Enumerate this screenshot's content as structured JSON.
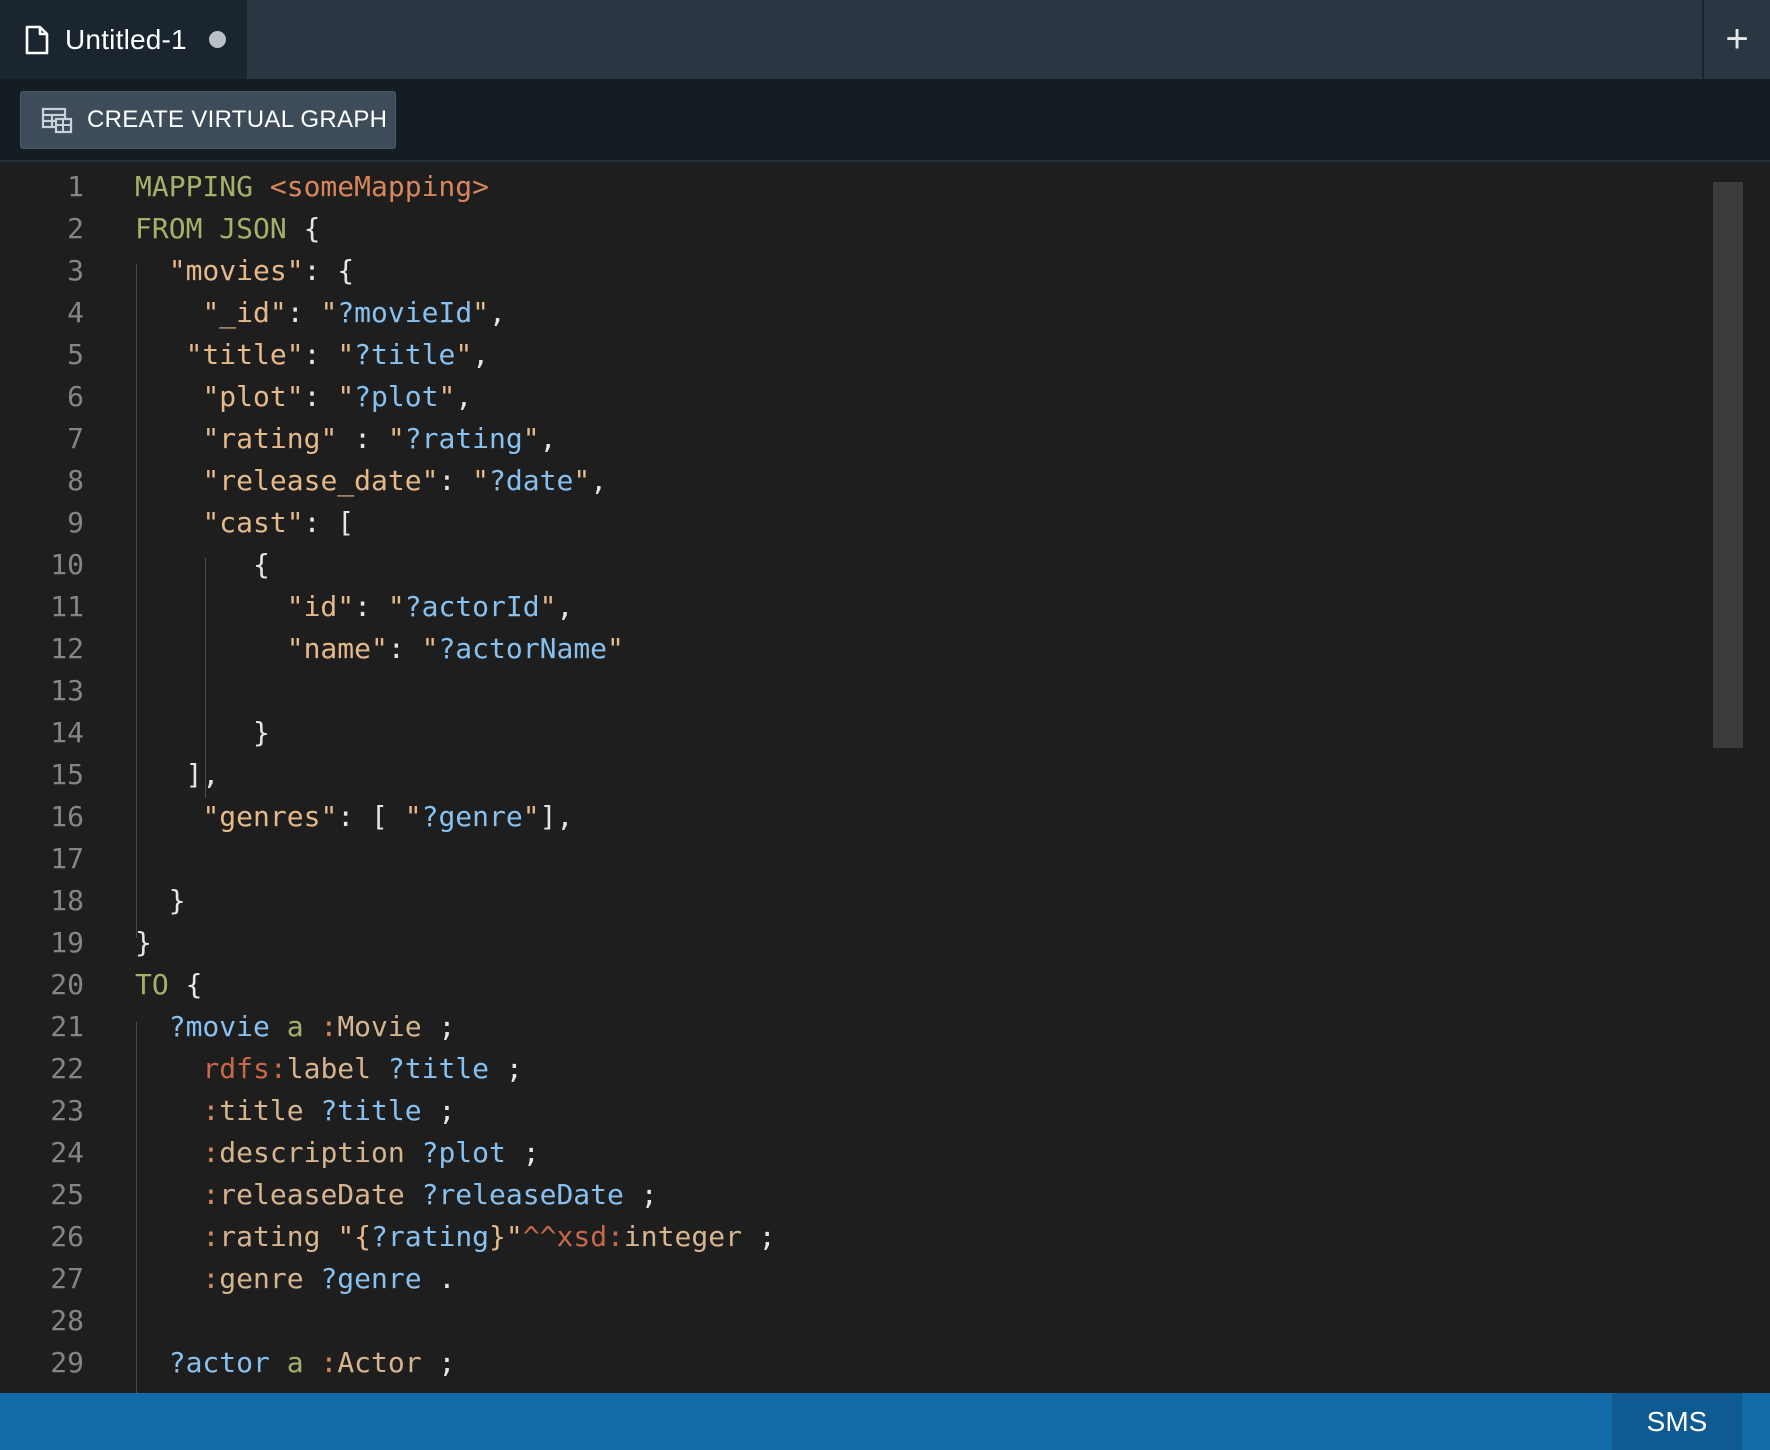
{
  "tabs": [
    {
      "title": "Untitled-1",
      "modified": true
    }
  ],
  "new_tab_label": "+",
  "toolbar": {
    "create_virtual_graph_label": "CREATE VIRTUAL GRAPH"
  },
  "editor": {
    "lines": [
      {
        "n": "1",
        "tokens": [
          [
            "kw",
            "MAPPING "
          ],
          [
            "iri",
            "<someMapping>"
          ]
        ]
      },
      {
        "n": "2",
        "tokens": [
          [
            "kw",
            "FROM JSON "
          ],
          [
            "pun",
            "{"
          ]
        ]
      },
      {
        "n": "3",
        "tokens": [
          [
            "pun",
            "  "
          ],
          [
            "key",
            "\"movies\""
          ],
          [
            "pun",
            ": {"
          ]
        ]
      },
      {
        "n": "4",
        "tokens": [
          [
            "pun",
            "    "
          ],
          [
            "key",
            "\"_id\""
          ],
          [
            "pun",
            ": "
          ],
          [
            "key",
            "\""
          ],
          [
            "var",
            "?movieId"
          ],
          [
            "key",
            "\""
          ],
          [
            "pun",
            ","
          ]
        ]
      },
      {
        "n": "5",
        "tokens": [
          [
            "pun",
            "   "
          ],
          [
            "key",
            "\"title\""
          ],
          [
            "pun",
            ": "
          ],
          [
            "key",
            "\""
          ],
          [
            "var",
            "?title"
          ],
          [
            "key",
            "\""
          ],
          [
            "pun",
            ","
          ]
        ]
      },
      {
        "n": "6",
        "tokens": [
          [
            "pun",
            "    "
          ],
          [
            "key",
            "\"plot\""
          ],
          [
            "pun",
            ": "
          ],
          [
            "key",
            "\""
          ],
          [
            "var",
            "?plot"
          ],
          [
            "key",
            "\""
          ],
          [
            "pun",
            ","
          ]
        ]
      },
      {
        "n": "7",
        "tokens": [
          [
            "pun",
            "    "
          ],
          [
            "key",
            "\"rating\""
          ],
          [
            "pun",
            " : "
          ],
          [
            "key",
            "\""
          ],
          [
            "var",
            "?rating"
          ],
          [
            "key",
            "\""
          ],
          [
            "pun",
            ","
          ]
        ]
      },
      {
        "n": "8",
        "tokens": [
          [
            "pun",
            "    "
          ],
          [
            "key",
            "\"release_date\""
          ],
          [
            "pun",
            ": "
          ],
          [
            "key",
            "\""
          ],
          [
            "var",
            "?date"
          ],
          [
            "key",
            "\""
          ],
          [
            "pun",
            ","
          ]
        ]
      },
      {
        "n": "9",
        "tokens": [
          [
            "pun",
            "    "
          ],
          [
            "key",
            "\"cast\""
          ],
          [
            "pun",
            ": ["
          ]
        ]
      },
      {
        "n": "10",
        "tokens": [
          [
            "pun",
            "       {"
          ]
        ]
      },
      {
        "n": "11",
        "tokens": [
          [
            "pun",
            "         "
          ],
          [
            "key",
            "\"id\""
          ],
          [
            "pun",
            ": "
          ],
          [
            "key",
            "\""
          ],
          [
            "var",
            "?actorId"
          ],
          [
            "key",
            "\""
          ],
          [
            "pun",
            ","
          ]
        ]
      },
      {
        "n": "12",
        "tokens": [
          [
            "pun",
            "         "
          ],
          [
            "key",
            "\"name\""
          ],
          [
            "pun",
            ": "
          ],
          [
            "key",
            "\""
          ],
          [
            "var",
            "?actorName"
          ],
          [
            "key",
            "\""
          ]
        ]
      },
      {
        "n": "13",
        "tokens": []
      },
      {
        "n": "14",
        "tokens": [
          [
            "pun",
            "       }"
          ]
        ]
      },
      {
        "n": "15",
        "tokens": [
          [
            "pun",
            "   ],"
          ]
        ]
      },
      {
        "n": "16",
        "tokens": [
          [
            "pun",
            "    "
          ],
          [
            "key",
            "\"genres\""
          ],
          [
            "pun",
            ": [ "
          ],
          [
            "key",
            "\""
          ],
          [
            "var",
            "?genre"
          ],
          [
            "key",
            "\""
          ],
          [
            "pun",
            "],"
          ]
        ]
      },
      {
        "n": "17",
        "tokens": []
      },
      {
        "n": "18",
        "tokens": [
          [
            "pun",
            "  }"
          ]
        ]
      },
      {
        "n": "19",
        "tokens": [
          [
            "pun",
            "}"
          ]
        ]
      },
      {
        "n": "20",
        "tokens": [
          [
            "kw",
            "TO "
          ],
          [
            "pun",
            "{"
          ]
        ]
      },
      {
        "n": "21",
        "tokens": [
          [
            "pun",
            "  "
          ],
          [
            "var",
            "?movie"
          ],
          [
            "kw",
            " a "
          ],
          [
            "pfx",
            ":"
          ],
          [
            "loc",
            "Movie"
          ],
          [
            "pun",
            " ;"
          ]
        ]
      },
      {
        "n": "22",
        "tokens": [
          [
            "pun",
            "    "
          ],
          [
            "rdf",
            "rdfs:"
          ],
          [
            "loc",
            "label"
          ],
          [
            "pun",
            " "
          ],
          [
            "var",
            "?title"
          ],
          [
            "pun",
            " ;"
          ]
        ]
      },
      {
        "n": "23",
        "tokens": [
          [
            "pun",
            "    "
          ],
          [
            "pfx",
            ":"
          ],
          [
            "loc",
            "title"
          ],
          [
            "pun",
            " "
          ],
          [
            "var",
            "?title"
          ],
          [
            "pun",
            " ;"
          ]
        ]
      },
      {
        "n": "24",
        "tokens": [
          [
            "pun",
            "    "
          ],
          [
            "pfx",
            ":"
          ],
          [
            "loc",
            "description"
          ],
          [
            "pun",
            " "
          ],
          [
            "var",
            "?plot"
          ],
          [
            "pun",
            " ;"
          ]
        ]
      },
      {
        "n": "25",
        "tokens": [
          [
            "pun",
            "    "
          ],
          [
            "pfx",
            ":"
          ],
          [
            "loc",
            "releaseDate"
          ],
          [
            "pun",
            " "
          ],
          [
            "var",
            "?releaseDate"
          ],
          [
            "pun",
            " ;"
          ]
        ]
      },
      {
        "n": "26",
        "tokens": [
          [
            "pun",
            "    "
          ],
          [
            "pfx",
            ":"
          ],
          [
            "loc",
            "rating"
          ],
          [
            "pun",
            " "
          ],
          [
            "key",
            "\"{"
          ],
          [
            "var",
            "?rating"
          ],
          [
            "key",
            "}\""
          ],
          [
            "rdf",
            "^^xsd:"
          ],
          [
            "loc",
            "integer"
          ],
          [
            "pun",
            " ;"
          ]
        ]
      },
      {
        "n": "27",
        "tokens": [
          [
            "pun",
            "    "
          ],
          [
            "pfx",
            ":"
          ],
          [
            "loc",
            "genre"
          ],
          [
            "pun",
            " "
          ],
          [
            "var",
            "?genre"
          ],
          [
            "pun",
            " ."
          ]
        ]
      },
      {
        "n": "28",
        "tokens": []
      },
      {
        "n": "29",
        "tokens": [
          [
            "pun",
            "  "
          ],
          [
            "var",
            "?actor"
          ],
          [
            "kw",
            " a "
          ],
          [
            "pfx",
            ":"
          ],
          [
            "loc",
            "Actor"
          ],
          [
            "pun",
            " ;"
          ]
        ]
      }
    ]
  },
  "status": {
    "language_mode": "SMS"
  },
  "colors": {
    "tab_active_bg": "#1b2530",
    "tabbar_bg": "#2a3642",
    "toolbar_bg": "#141c24",
    "button_bg": "#3e4c5a",
    "editor_bg": "#1e1e1e",
    "statusbar_bg": "#136aa8",
    "keyword": "#a3b26a",
    "iri": "#d8865b",
    "string_key": "#e6b98a",
    "variable": "#88c1f0"
  }
}
